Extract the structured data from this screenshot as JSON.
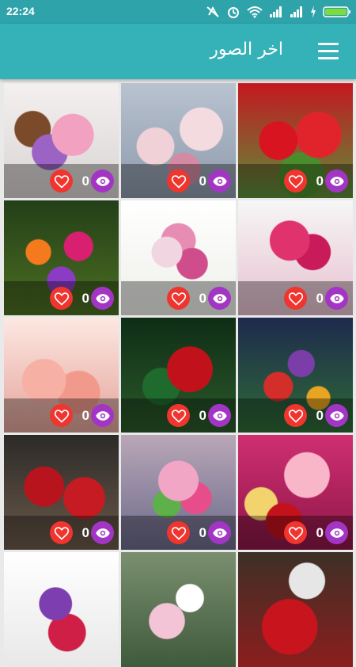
{
  "status_bar": {
    "time": "22:24",
    "icons": [
      "data-off-icon",
      "alarm-icon",
      "wifi-icon",
      "signal-icon",
      "signal-icon",
      "charging-icon",
      "battery-icon"
    ]
  },
  "app_bar": {
    "title": "اخر الصور",
    "menu_icon": "hamburger-menu-icon"
  },
  "colors": {
    "status_bar": "#2fa3aa",
    "app_bar": "#35b1b8",
    "like_button": "#f0352f",
    "view_button": "#a335c5"
  },
  "images": [
    {
      "likes": "0",
      "theme": "pink roses with heart"
    },
    {
      "likes": "0",
      "theme": "cream pink roses"
    },
    {
      "likes": "0",
      "theme": "red roses"
    },
    {
      "likes": "0",
      "theme": "mixed garden flowers"
    },
    {
      "likes": "0",
      "theme": "mixed bouquet"
    },
    {
      "likes": "0",
      "theme": "pink roses in vase"
    },
    {
      "likes": "0",
      "theme": "peach roses"
    },
    {
      "likes": "0",
      "theme": "single red rose"
    },
    {
      "likes": "0",
      "theme": "fantasy flowers"
    },
    {
      "likes": "0",
      "theme": "red roses bunch"
    },
    {
      "likes": "0",
      "theme": "pink bouquet wrap"
    },
    {
      "likes": "0",
      "theme": "gift box with roses"
    },
    {
      "likes": "",
      "theme": "purple red flowers"
    },
    {
      "likes": "",
      "theme": "lilies bouquet"
    },
    {
      "likes": "",
      "theme": "red roses basket"
    }
  ]
}
